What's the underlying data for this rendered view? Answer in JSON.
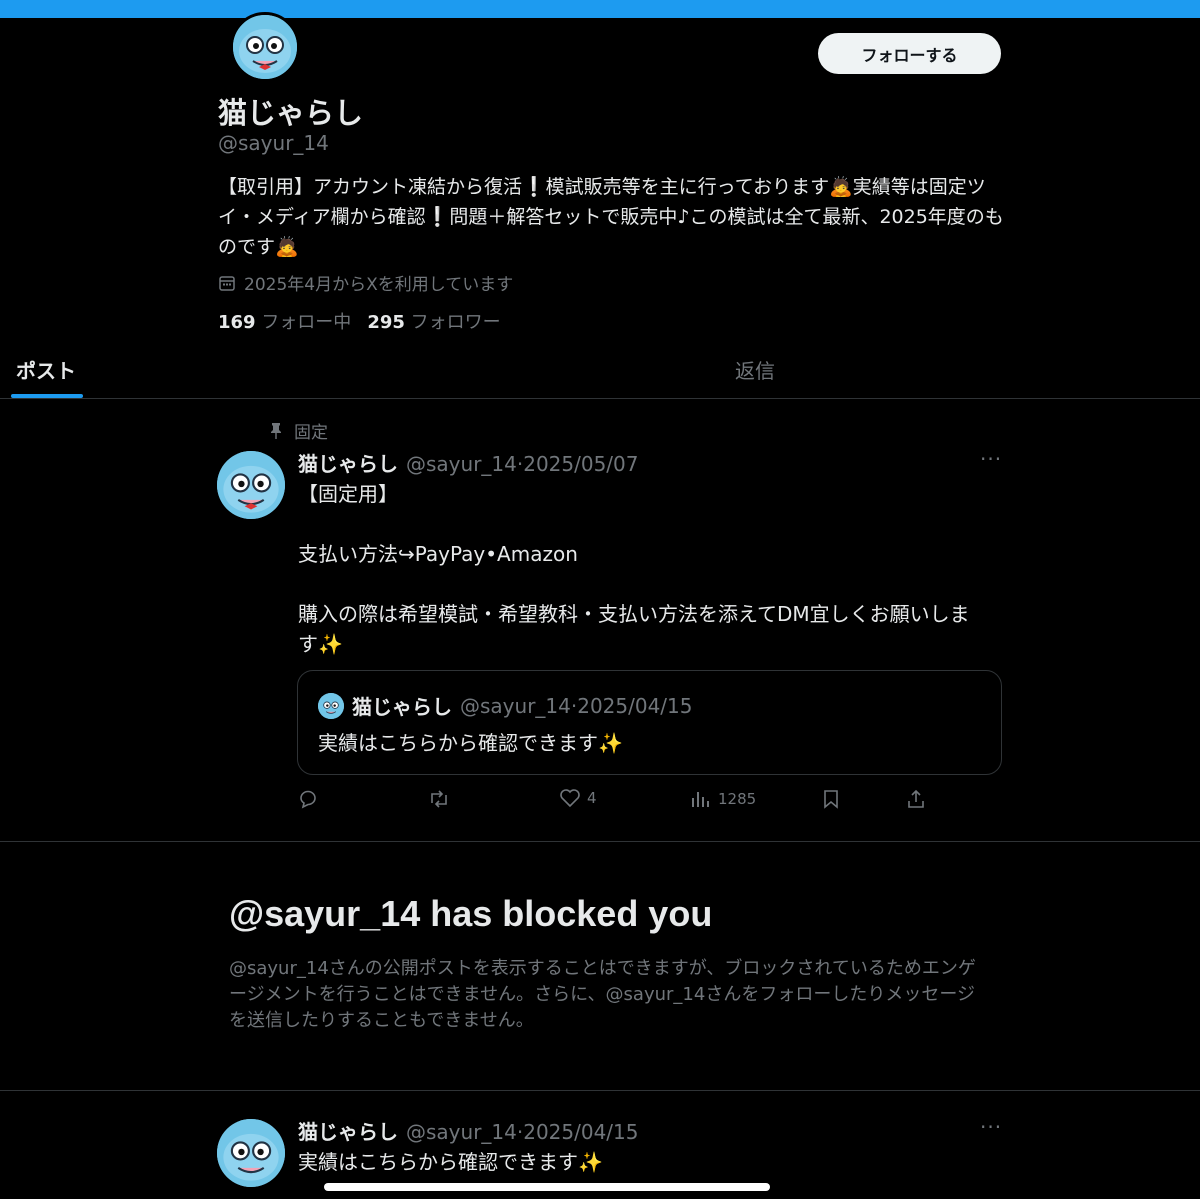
{
  "profile": {
    "display_name": "猫じゃらし",
    "handle": "@sayur_14",
    "follow_label": "フォローする",
    "bio": "【取引用】アカウント凍結から復活❕模試販売等を主に行っております🙇実績等は固定ツイ・メディア欄から確認❕問題＋解答セットで販売中♪この模試は全て最新、2025年度のものです🙇",
    "joined": "2025年4月からXを利用しています",
    "following_count": "169",
    "following_label": "フォロー中",
    "followers_count": "295",
    "followers_label": "フォロワー"
  },
  "tabs": {
    "posts": "ポスト",
    "replies": "返信"
  },
  "pinned_post": {
    "pinned_label": "固定",
    "name": "猫じゃらし",
    "meta": "@sayur_14·2025/05/07",
    "text": "【固定用】\n\n支払い方法↪PayPay•Amazon\n\n購入の際は希望模試・希望教科・支払い方法を添えてDM宜しくお願いしま\nす✨",
    "quote": {
      "name": "猫じゃらし",
      "meta": "@sayur_14·2025/04/15",
      "text": "実績はこちらから確認できます✨"
    },
    "likes": "4",
    "views": "1285"
  },
  "blocked": {
    "title": "@sayur_14 has blocked you",
    "body": "@sayur_14さんの公開ポストを表示することはできますが、ブロックされているためエンゲージメントを行うことはできません。さらに、@sayur_14さんをフォローしたりメッセージを送信したりすることもできません。"
  },
  "second_post": {
    "name": "猫じゃらし",
    "meta": "@sayur_14·2025/04/15",
    "text": "実績はこちらから確認できます✨"
  },
  "colors": {
    "accent": "#1d9bf0",
    "muted": "#71767b",
    "text": "#e7e9ea",
    "border": "#2f3336"
  }
}
